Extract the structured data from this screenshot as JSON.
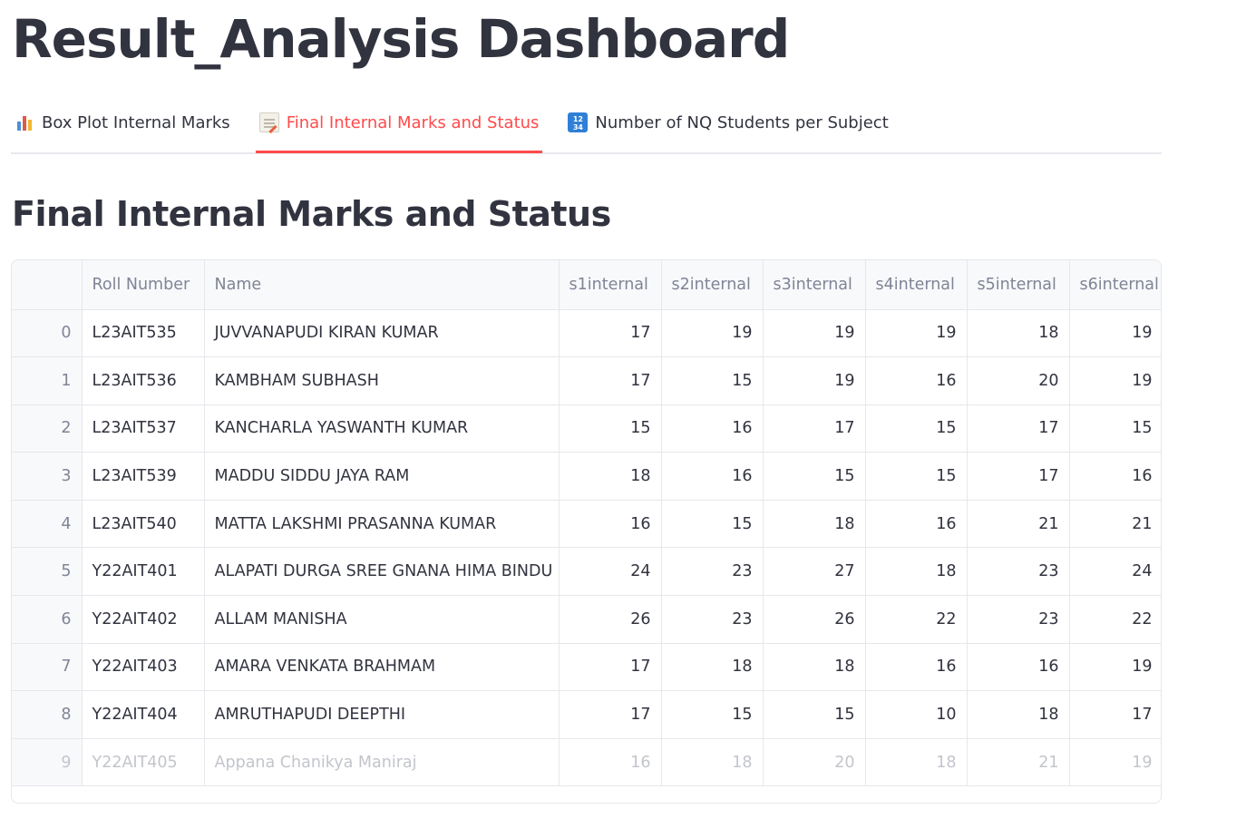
{
  "page": {
    "title": "Result_Analysis Dashboard"
  },
  "tabs": [
    {
      "label": "Box Plot Internal Marks",
      "icon": "bar-chart-icon",
      "active": false
    },
    {
      "label": "Final Internal Marks and Status",
      "icon": "memo-icon",
      "active": true
    },
    {
      "label": "Number of NQ Students per Subject",
      "icon": "numbers-icon",
      "active": false
    }
  ],
  "section": {
    "title": "Final Internal Marks and Status"
  },
  "colors": {
    "accent": "#ff4b4b",
    "text": "#31333f",
    "muted": "#808495",
    "border": "#e6e7eb"
  },
  "table": {
    "columns": [
      "",
      "Roll Number",
      "Name",
      "s1internal",
      "s2internal",
      "s3internal",
      "s4internal",
      "s5internal",
      "s6internal"
    ],
    "rows": [
      {
        "idx": "0",
        "roll": "L23AIT535",
        "name": "JUVVANAPUDI KIRAN KUMAR",
        "s1": "17",
        "s2": "19",
        "s3": "19",
        "s4": "19",
        "s5": "18",
        "s6": "19"
      },
      {
        "idx": "1",
        "roll": "L23AIT536",
        "name": "KAMBHAM SUBHASH",
        "s1": "17",
        "s2": "15",
        "s3": "19",
        "s4": "16",
        "s5": "20",
        "s6": "19"
      },
      {
        "idx": "2",
        "roll": "L23AIT537",
        "name": "KANCHARLA YASWANTH KUMAR",
        "s1": "15",
        "s2": "16",
        "s3": "17",
        "s4": "15",
        "s5": "17",
        "s6": "15"
      },
      {
        "idx": "3",
        "roll": "L23AIT539",
        "name": "MADDU SIDDU JAYA RAM",
        "s1": "18",
        "s2": "16",
        "s3": "15",
        "s4": "15",
        "s5": "17",
        "s6": "16"
      },
      {
        "idx": "4",
        "roll": "L23AIT540",
        "name": "MATTA LAKSHMI PRASANNA KUMAR",
        "s1": "16",
        "s2": "15",
        "s3": "18",
        "s4": "16",
        "s5": "21",
        "s6": "21"
      },
      {
        "idx": "5",
        "roll": "Y22AIT401",
        "name": "ALAPATI DURGA SREE GNANA HIMA BINDU",
        "s1": "24",
        "s2": "23",
        "s3": "27",
        "s4": "18",
        "s5": "23",
        "s6": "24"
      },
      {
        "idx": "6",
        "roll": "Y22AIT402",
        "name": "ALLAM MANISHA",
        "s1": "26",
        "s2": "23",
        "s3": "26",
        "s4": "22",
        "s5": "23",
        "s6": "22"
      },
      {
        "idx": "7",
        "roll": "Y22AIT403",
        "name": "AMARA VENKATA BRAHMAM",
        "s1": "17",
        "s2": "18",
        "s3": "18",
        "s4": "16",
        "s5": "16",
        "s6": "19"
      },
      {
        "idx": "8",
        "roll": "Y22AIT404",
        "name": "AMRUTHAPUDI DEEPTHI",
        "s1": "17",
        "s2": "15",
        "s3": "15",
        "s4": "10",
        "s5": "18",
        "s6": "17"
      },
      {
        "idx": "9",
        "roll": "Y22AIT405",
        "name": "Appana Chanikya Maniraj",
        "s1": "16",
        "s2": "18",
        "s3": "20",
        "s4": "18",
        "s5": "21",
        "s6": "19"
      }
    ]
  }
}
